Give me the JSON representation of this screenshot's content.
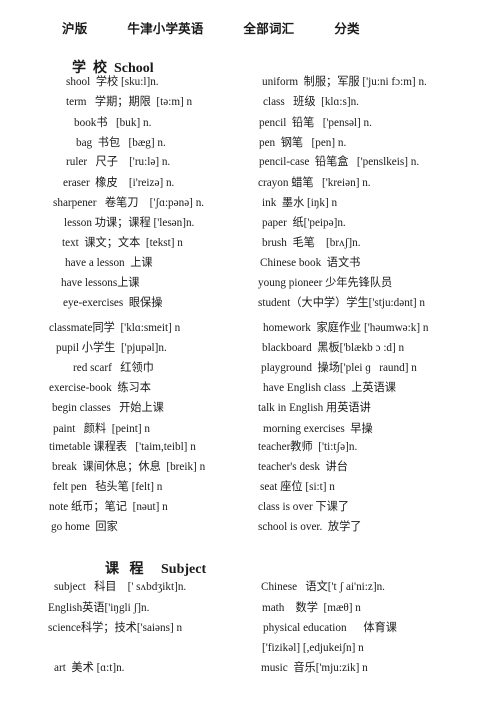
{
  "document": {
    "title": "沪版   牛津小学英语   全部词汇   分类"
  },
  "sections": [
    {
      "title": "学  校  School",
      "left": [
        "shool  学校 [sku:l]n.",
        "term   学期；期限  [tə:m] n",
        "book书   [buk] n.",
        "bag  书包   [bæg] n.",
        "ruler   尺子    ['ru:lə] n.",
        "eraser  橡皮    [i'reizə] n.",
        "sharpener   卷笔刀    ['ʃɑ:pənə] n.",
        "lesson 功课；课程 ['lesən]n.",
        "text  课文；文本  [tekst] n",
        "have a lesson  上课",
        "have lessons上课",
        "eye-exercises  眼保操",
        "classmate同学  ['klɑ:smeit] n",
        "pupil 小学生  ['pjupəl]n.",
        "red scarf   红领巾",
        "exercise-book  练习本",
        "begin classes   开始上课",
        "paint   颜料  [peint] n",
        "timetable 课程表   ['taim,teibl] n",
        "break  课间休息；休息  [breik] n",
        "felt pen   毡头笔 [felt] n",
        "note 纸币；笔记  [nəut] n",
        "go home  回家"
      ],
      "right": [
        "uniform  制服；军服 ['ju:ni fɔ:m] n.",
        "class   班级  [klɑ:s]n.",
        "pencil  铅笔   ['pensəl] n.",
        "pen  钢笔   [pen] n.",
        "pencil-case  铅笔盒   ['penslkeis] n.",
        "crayon 蜡笔   ['kreiən] n.",
        "ink  墨水 [iŋk] n",
        "paper  纸['peipə]n.",
        "brush  毛笔    [brʌʃ]n.",
        "Chinese book  语文书",
        "young pioneer 少年先锋队员",
        "student（大中学）学生['stju:dənt] n",
        "homework  家庭作业 ['həumwə:k] n",
        "blackboard  黑板['blækb ɔ :d] n",
        "playground  操场['plei ɡ   raund] n",
        "have English class  上英语课",
        "talk in English 用英语讲",
        "morning exercises  早操",
        "teacher教师  ['ti:tʃə]n.",
        "teacher's desk  讲台",
        "seat 座位 [si:t] n",
        "class is over 下课了",
        "school is over.  放学了"
      ]
    },
    {
      "title": "课   程     Subject",
      "left": [
        "subject   科目    [' sʌbdʒikt]n.",
        "English英语['iŋgli ʃ]n.",
        "science科学；技术['saiəns] n",
        "",
        "art  美术 [ɑ:t]n."
      ],
      "right": [
        "Chinese   语文['t ʃ ai'ni:z]n.",
        "math    数学  [mæθ] n",
        "physical education      体育课",
        "['fizikəl] [,edjukeiʃn] n",
        "music  音乐['mju:zik] n"
      ]
    }
  ]
}
